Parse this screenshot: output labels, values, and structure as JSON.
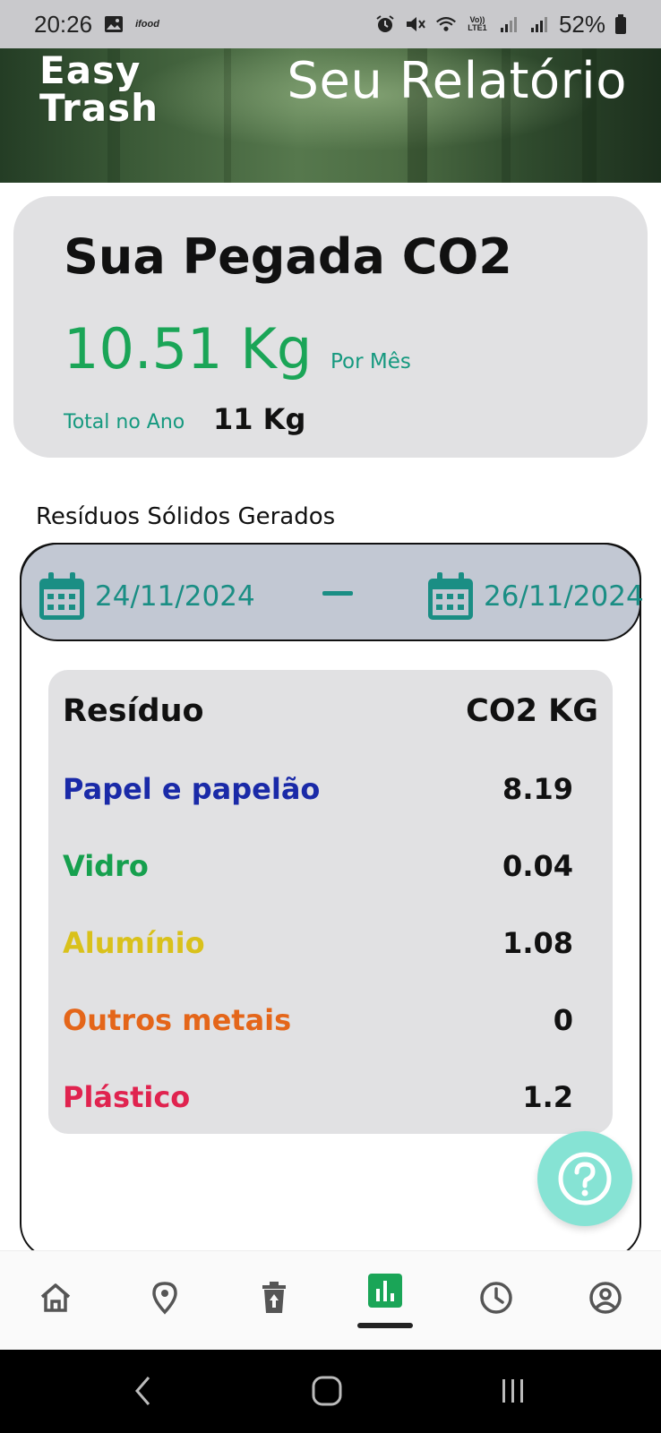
{
  "status_bar": {
    "time": "20:26",
    "notification_app": "ifood",
    "battery": "52%",
    "icons": [
      "image-icon",
      "alarm-icon",
      "mute-icon",
      "wifi-icon",
      "volte-icon",
      "signal-icon",
      "signal-icon",
      "battery-icon"
    ],
    "volte_text": "Vo)) LTE1"
  },
  "header": {
    "logo_line1": "Easy",
    "logo_line2": "Trash",
    "title": "Seu Relatório"
  },
  "co2_card": {
    "title": "Sua Pegada CO2",
    "value": "10.51 Kg",
    "per_label": "Por Mês",
    "total_label": "Total no Ano",
    "total_value": "11 Kg"
  },
  "section_title": "Resíduos Sólidos Gerados",
  "date_range": {
    "start": "24/11/2024",
    "end": "26/11/2024",
    "icon": "calendar-icon"
  },
  "table": {
    "headers": [
      "Resíduo",
      "CO2 KG"
    ],
    "rows": [
      {
        "name": "Papel e papelão",
        "value": "8.19",
        "color": "#1a2aa8"
      },
      {
        "name": "Vidro",
        "value": "0.04",
        "color": "#16a04e"
      },
      {
        "name": "Alumínio",
        "value": "1.08",
        "color": "#d9c11b"
      },
      {
        "name": "Outros metais",
        "value": "0",
        "color": "#e4661a"
      },
      {
        "name": "Plástico",
        "value": "1.2",
        "color": "#e0234f"
      }
    ]
  },
  "fab": {
    "icon": "help-icon"
  },
  "bottom_nav": {
    "items": [
      "home-icon",
      "location-pin-icon",
      "recycle-bin-icon",
      "report-chart-icon",
      "history-clock-icon",
      "profile-icon"
    ],
    "active": "report-chart-icon"
  },
  "colors": {
    "accent_green": "#1aa557",
    "teal": "#1a8e84",
    "card_bg": "#e1e1e3",
    "date_bar_bg": "#c2c8d3",
    "fab_bg": "#86e3d4"
  }
}
